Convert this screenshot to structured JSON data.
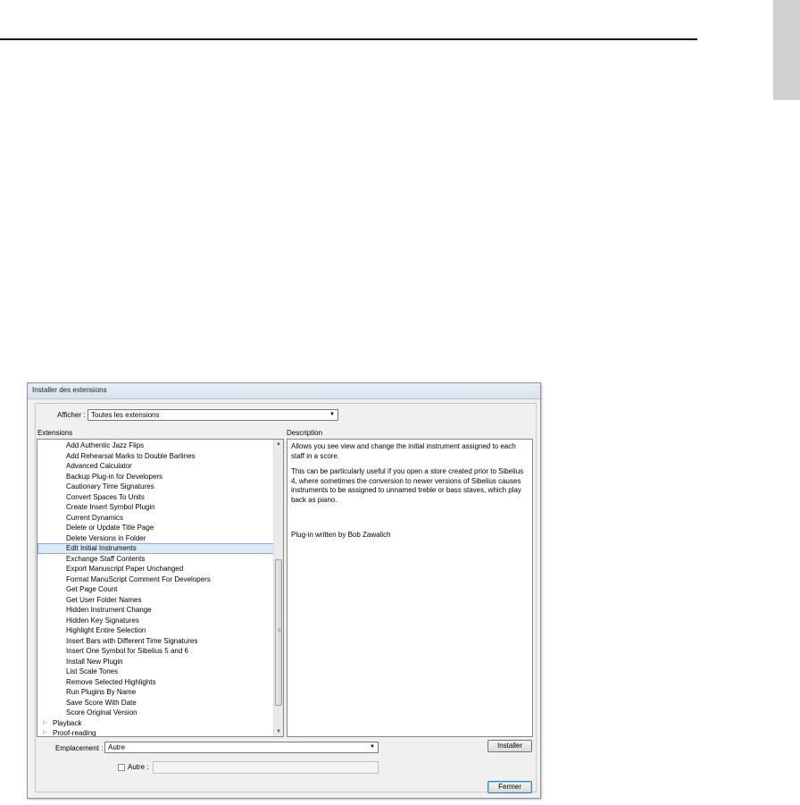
{
  "dialog": {
    "title": "Installer des extensions",
    "show_label": "Afficher :",
    "show_value": "Toutes les extensions",
    "extensions_header": "Extensions",
    "description_header": "Description",
    "plugins": [
      "Add Authentic Jazz Flips",
      "Add Rehearsal Marks to Double Barlines",
      "Advanced Calculator",
      "Backup Plug-in for Developers",
      "Cautionary Time Signatures",
      "Convert Spaces To Units",
      "Create Insert Symbol Plugin",
      "Current Dynamics",
      "Delete or Update Title Page",
      "Delete Versions in Folder",
      "Edit Initial Instruments",
      "Exchange Staff Contents",
      "Export Manuscript Paper Unchanged",
      "Format ManuScript Comment For Developers",
      "Get Page Count",
      "Get User Folder Names",
      "Hidden Instrument Change",
      "Hidden Key Signatures",
      "Highlight Entire Selection",
      "Insert Bars with Different Time Signatures",
      "Insert One Symbol for Sibelius 5 and 6",
      "Install New Plugin",
      "List Scale Tones",
      "Remove Selected Highlights",
      "Run Plugins By Name",
      "Save Score With Date",
      "Score Original Version"
    ],
    "selected_plugin": "Edit Initial Instruments",
    "categories": [
      "Playback",
      "Proof-reading"
    ],
    "description": [
      "Allows you see view and change the initial instrument assigned to each staff in a score.",
      "This can be particularly useful if you open a store created prior to Sibelius 4, where sometimes the conversion to newer versions of Sibelius causes instruments to be assigned to unnamed treble or bass staves, which play back as piano.",
      "Plug-in written by Bob Zawalich"
    ],
    "location_label": "Emplacement :",
    "location_value": "Autre",
    "other_label": "Autre :",
    "other_value": "",
    "install_button": "Installer",
    "close_button": "Fermer"
  }
}
